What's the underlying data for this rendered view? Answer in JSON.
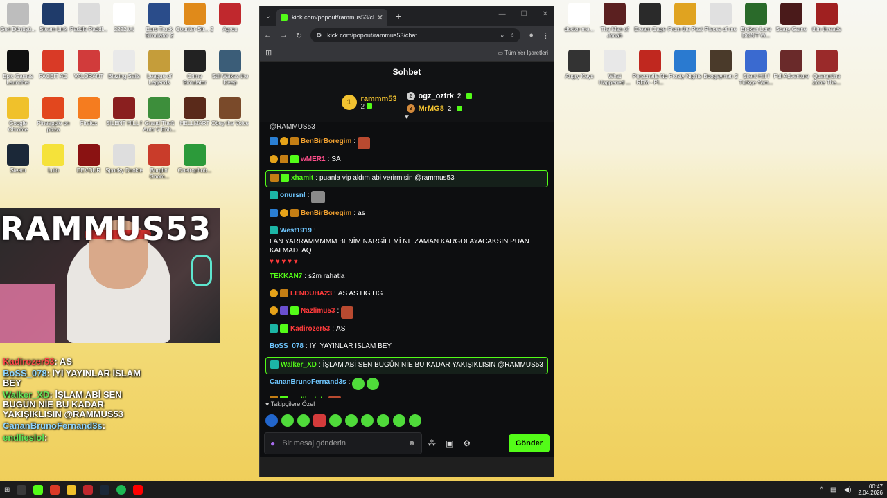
{
  "desktop_left": [
    {
      "label": "Geri Dönüşü...",
      "color": "#bdbdbd"
    },
    {
      "label": "Steam Link",
      "color": "#1f3b6a"
    },
    {
      "label": "Paddle Paddl...",
      "color": "#dcdcdc"
    },
    {
      "label": "2222.txt",
      "color": "#ffffff"
    },
    {
      "label": "Euro Truck Simulator 2",
      "color": "#2a4c8a"
    },
    {
      "label": "Counter-Str... 2",
      "color": "#e08a1a"
    },
    {
      "label": "Agrou",
      "color": "#c0282d"
    },
    {
      "label": "Epic Games Launcher",
      "color": "#111111"
    },
    {
      "label": "FACEIT AC",
      "color": "#d93a26"
    },
    {
      "label": "VALORANT",
      "color": "#d13b3b"
    },
    {
      "label": "Blazing Sails",
      "color": "#e9e9e9"
    },
    {
      "label": "League of Legends",
      "color": "#c59d3a"
    },
    {
      "label": "Crime Simulator",
      "color": "#222222"
    },
    {
      "label": "Still Wakes the Deep",
      "color": "#3b5d78"
    },
    {
      "label": "Google Chrome",
      "color": "#f0c12b"
    },
    {
      "label": "Pineapple on pizza",
      "color": "#e2471e"
    },
    {
      "label": "Firefox",
      "color": "#f57c1f"
    },
    {
      "label": "SILENT HILL f",
      "color": "#8a1f1f"
    },
    {
      "label": "Grand Theft Auto V Enh...",
      "color": "#3d8e3b"
    },
    {
      "label": "HELLMART",
      "color": "#5a2a1a"
    },
    {
      "label": "Obey the Voice",
      "color": "#7a4a2a"
    },
    {
      "label": "Steam",
      "color": "#1b2838"
    },
    {
      "label": "Luto",
      "color": "#f5e23a"
    },
    {
      "label": "DEVOUR",
      "color": "#8a1212"
    },
    {
      "label": "Spooky Dookie",
      "color": "#dedede"
    },
    {
      "label": "Burglin' Gnom...",
      "color": "#c93c2a"
    },
    {
      "label": "Oneirophob...",
      "color": "#2c9a3a"
    }
  ],
  "desktop_right": [
    {
      "label": "doctor me...",
      "color": "#ffffff"
    },
    {
      "label": "The Man of Jonah",
      "color": "#5b2020"
    },
    {
      "label": "Dream Cage",
      "color": "#2a2a2a"
    },
    {
      "label": "From the Past",
      "color": "#e0a320"
    },
    {
      "label": "Pieces of me",
      "color": "#e0e0e0"
    },
    {
      "label": "Broken Lore DON'T W...",
      "color": "#2a6a2a"
    },
    {
      "label": "Scary Game",
      "color": "#4a1a1a"
    },
    {
      "label": "thin threads",
      "color": "#a02020"
    },
    {
      "label": "Angry Keys",
      "color": "#333333"
    },
    {
      "label": "What Happened ...",
      "color": "#e8e8e8"
    },
    {
      "label": "Personalia No REM - Pl...",
      "color": "#c0281f"
    },
    {
      "label": "Frosty Nights",
      "color": "#2a7ad0"
    },
    {
      "label": "Boogeyman 2",
      "color": "#4a3a2a"
    },
    {
      "label": "Silent Hill f Türkçe Yam...",
      "color": "#3a6ad0"
    },
    {
      "label": "Full Adventure",
      "color": "#6a2a2a"
    },
    {
      "label": "Quarantine Zone The...",
      "color": "#9a2a2a"
    }
  ],
  "browser": {
    "tab_title": "kick.com/popout/rammus53/ch",
    "url": "kick.com/popout/rammus53/chat",
    "bookmarks_label": "Tüm Yer İşaretleri"
  },
  "chat": {
    "header": "Sohbet",
    "leaders": {
      "first": {
        "rank": "1",
        "name": "rammm53",
        "count": "2"
      },
      "second": {
        "rank": "2",
        "name": "ogz_oztrk",
        "count": "2"
      },
      "third": {
        "rank": "3",
        "name": "MrMG8",
        "count": "2"
      }
    },
    "cut_top": "@RAMMUS53",
    "messages": [
      {
        "user": "BenBirBoregim",
        "sep": ":",
        "text": "",
        "color": "#f0a030"
      },
      {
        "user": "wMER1",
        "sep": ":",
        "text": "SA",
        "color": "#ff4e8b"
      },
      {
        "user": "xhamit",
        "sep": ":",
        "text": "puanla vip aldım abi verirmisin @rammus53",
        "color": "#53fc18"
      },
      {
        "user": "onursnl",
        "sep": ":",
        "text": "",
        "color": "#6fc7ff"
      },
      {
        "user": "BenBirBoregim",
        "sep": ":",
        "text": "as",
        "color": "#f0a030"
      },
      {
        "user": "West1919",
        "sep": ":",
        "text": "LAN YARRAMMMMM BENİM NARGİLEMİ NE ZAMAN KARGOLAYACAKSIN PUAN KALMADI AQ",
        "color": "#6fc7ff"
      },
      {
        "user": "TEKKAN7",
        "sep": ":",
        "text": "s2m rahatla",
        "color": "#53fc18"
      },
      {
        "user": "LENDUHA23",
        "sep": ":",
        "text": "AS AS HG HG",
        "color": "#ff3b3b"
      },
      {
        "user": "Nazlimu53",
        "sep": ":",
        "text": "",
        "color": "#ff3b3b"
      },
      {
        "user": "Kadirozer53",
        "sep": ":",
        "text": "AS",
        "color": "#ff3b3b"
      },
      {
        "user": "BoSS_078",
        "sep": ":",
        "text": "İYİ YAYINLAR İSLAM BEY",
        "color": "#6fc7ff"
      },
      {
        "user": "Walker_XD",
        "sep": ":",
        "text": "İŞLAM ABİ SEN BUGÜN NİE BU KADAR YAKIŞIKLISIN @RAMMUS53",
        "color": "#53fc18"
      },
      {
        "user": "CananBrunoFernand3s",
        "sep": ":",
        "text": "",
        "color": "#6fc7ff"
      },
      {
        "user": "endlieslol",
        "sep": ":",
        "text": "",
        "color": "#53fc18"
      }
    ],
    "hearts": "♥ ♥ ♥ ♥ ♥",
    "followers_only": "Takipçilere Özel",
    "input_placeholder": "Bir mesaj gönderin",
    "send_label": "Gönder"
  },
  "overlay": {
    "lines": [
      {
        "user": "Kadirozer53",
        "text": ": AS"
      },
      {
        "user": "BoSS_078",
        "text": ": İYİ YAYINLAR İSLAM BEY"
      },
      {
        "user": "Walker_XD",
        "text": ": İŞLAM ABİ SEN BUGÜN NİE BU KADAR YAKIŞIKLISIN @RAMMUS53"
      },
      {
        "user": "CananBrunoFernand3s",
        "text": ":"
      },
      {
        "user": "endlieslol",
        "text": ":"
      }
    ],
    "webcam_name": "RAMMUS53"
  },
  "taskbar": {
    "time": "00:47",
    "date": "2.04.2026"
  }
}
